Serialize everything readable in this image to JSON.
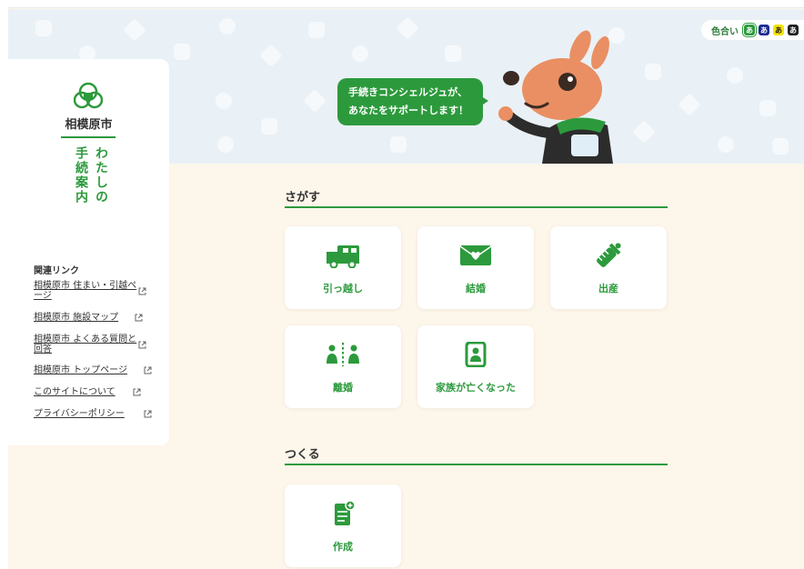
{
  "colors": {
    "green": "#2c9a3c",
    "cream": "#fdf6ea",
    "sky": "#e9f1f6"
  },
  "color_scheme": {
    "label": "色合い",
    "swatches": [
      {
        "glyph": "あ",
        "bg": "#2c9a3c",
        "fg": "#ffffff"
      },
      {
        "glyph": "あ",
        "bg": "#1d2a8f",
        "fg": "#ffffff"
      },
      {
        "glyph": "あ",
        "bg": "#f5e400",
        "fg": "#222222"
      },
      {
        "glyph": "あ",
        "bg": "#222222",
        "fg": "#ffffff"
      }
    ]
  },
  "sidebar": {
    "city": "相模原市",
    "title_col1": "わたしの",
    "title_col2": "手続案内",
    "links_heading": "関連リンク",
    "links": [
      {
        "label": "相模原市 住まい・引越ページ",
        "icon": "external-link-icon"
      },
      {
        "label": "相模原市 施設マップ",
        "icon": "external-link-icon"
      },
      {
        "label": "相模原市 よくある質問と回答",
        "icon": "external-link-icon"
      },
      {
        "label": "相模原市 トップページ",
        "icon": "external-link-icon"
      },
      {
        "label": "このサイトについて",
        "icon": "external-link-icon"
      },
      {
        "label": "プライバシーポリシー",
        "icon": "external-link-icon"
      }
    ]
  },
  "hero": {
    "bubble_line1": "手続きコンシェルジュが、",
    "bubble_line2": "あなたをサポートします！"
  },
  "sections": [
    {
      "title": "さがす",
      "cards": [
        {
          "label": "引っ越し",
          "icon": "truck-icon"
        },
        {
          "label": "結婚",
          "icon": "envelope-heart-icon"
        },
        {
          "label": "出産",
          "icon": "baby-bottle-icon"
        },
        {
          "label": "離婚",
          "icon": "separated-people-icon"
        },
        {
          "label": "家族が亡くなった",
          "icon": "memorial-portrait-icon"
        }
      ]
    },
    {
      "title": "つくる",
      "cards": [
        {
          "label": "作成",
          "icon": "new-document-icon"
        }
      ]
    }
  ]
}
